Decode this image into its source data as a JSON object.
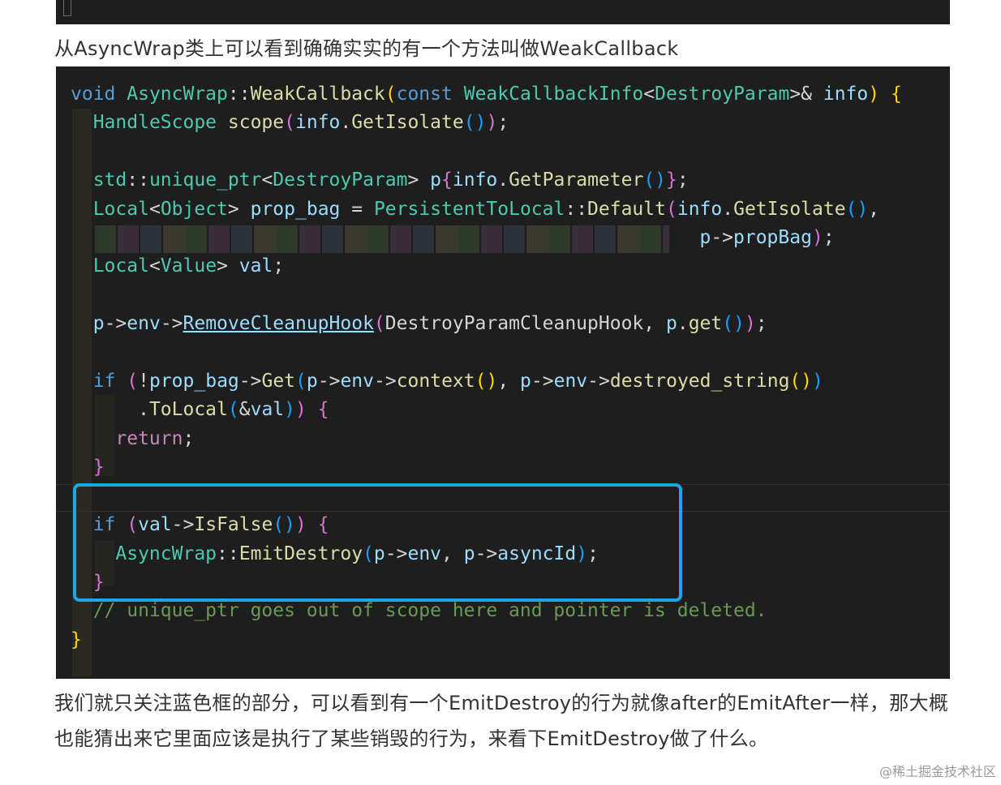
{
  "article": {
    "intro_text": "从AsyncWrap类上可以看到确确实实的有一个方法叫做WeakCallback",
    "outro_text": "我们就只关注蓝色框的部分，可以看到有一个EmitDestroy的行为就像after的EmitAfter一样，那大概也能猜出来它里面应该是执行了某些销毁的行为，来看下EmitDestroy做了什么。"
  },
  "code": {
    "language": "cpp",
    "highlight_color": "#1ea7e6",
    "lines": [
      "void AsyncWrap::WeakCallback(const WeakCallbackInfo<DestroyParam>& info) {",
      "  HandleScope scope(info.GetIsolate());",
      "",
      "  std::unique_ptr<DestroyParam> p{info.GetParameter()};",
      "  Local<Object> prop_bag = PersistentToLocal::Default(info.GetIsolate(),",
      "                                                        p->propBag);",
      "  Local<Value> val;",
      "",
      "  p->env->RemoveCleanupHook(DestroyParamCleanupHook, p.get());",
      "",
      "  if (!prop_bag->Get(p->env->context(), p->env->destroyed_string())",
      "      .ToLocal(&val)) {",
      "    return;",
      "  }",
      "",
      "  if (val->IsFalse()) {",
      "    AsyncWrap::EmitDestroy(p->env, p->asyncId);",
      "  }",
      "  // unique_ptr goes out of scope here and pointer is deleted.",
      "}"
    ]
  },
  "watermark": "@稀土掘金技术社区"
}
